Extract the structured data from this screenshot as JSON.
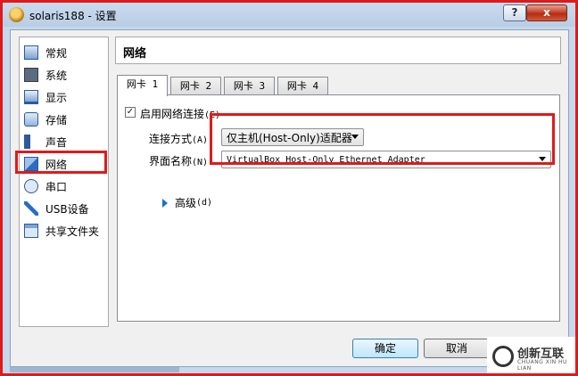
{
  "window": {
    "title": "solaris188 - 设置",
    "help_label": "?",
    "close_label": "x"
  },
  "sidebar": {
    "items": [
      {
        "label": "常规",
        "icon": "general-icon"
      },
      {
        "label": "系统",
        "icon": "system-icon"
      },
      {
        "label": "显示",
        "icon": "display-icon"
      },
      {
        "label": "存储",
        "icon": "storage-icon"
      },
      {
        "label": "声音",
        "icon": "audio-icon"
      },
      {
        "label": "网络",
        "icon": "network-icon",
        "selected": true
      },
      {
        "label": "串口",
        "icon": "serial-port-icon"
      },
      {
        "label": "USB设备",
        "icon": "usb-icon"
      },
      {
        "label": "共享文件夹",
        "icon": "shared-folder-icon"
      }
    ]
  },
  "page": {
    "title": "网络"
  },
  "tabs": [
    {
      "label": "网卡 1",
      "active": true
    },
    {
      "label": "网卡 2"
    },
    {
      "label": "网卡 3"
    },
    {
      "label": "网卡 4"
    }
  ],
  "adapter": {
    "enable_label": "启用网络连接",
    "enable_shortcut": "(E)",
    "enabled": true,
    "attached_label": "连接方式",
    "attached_shortcut": "(A):",
    "attached_value": "仅主机(Host-Only)适配器",
    "name_label": "界面名称",
    "name_shortcut": "(N):",
    "name_value": "VirtualBox Host-Only Ethernet Adapter",
    "advanced_label": "高级",
    "advanced_shortcut": "(d)"
  },
  "buttons": {
    "ok": "确定",
    "cancel": "取消"
  },
  "watermark": {
    "text": "创新互联",
    "sub": "CHUANG XIN HU LIAN"
  },
  "colors": {
    "highlight": "#e01a1a",
    "titlebar": "#c5d8ec",
    "accent": "#1f6fc9"
  }
}
